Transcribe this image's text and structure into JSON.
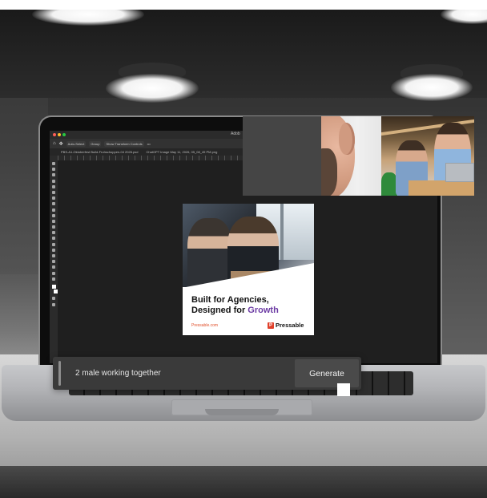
{
  "photoshop": {
    "app_title": "Adob",
    "options_bar": {
      "auto_select_label": "Auto-Select",
      "group_value": "Group",
      "show_transform_label": "Show Transform Controls",
      "more_label": "•••"
    },
    "tabs": [
      {
        "label": "PBS-A1-Oktoberfest Build-Fruhschoppen-04 2026.psd"
      },
      {
        "label": "ChatGPT Image May 11, 2026, 05_08_49 PM.png"
      }
    ]
  },
  "ad": {
    "headline_line1": "Built for Agencies,",
    "headline_line2_prefix": "Designed for ",
    "headline_accent": "Growth",
    "url": "Pressable.com",
    "brand": "Pressable",
    "brand_mark": "P"
  },
  "prompt": {
    "value": "2 male working together",
    "generate_label": "Generate"
  },
  "icons": [
    "home-icon",
    "move-tool-icon",
    "video-call-tile",
    "pressable-logo-icon"
  ]
}
